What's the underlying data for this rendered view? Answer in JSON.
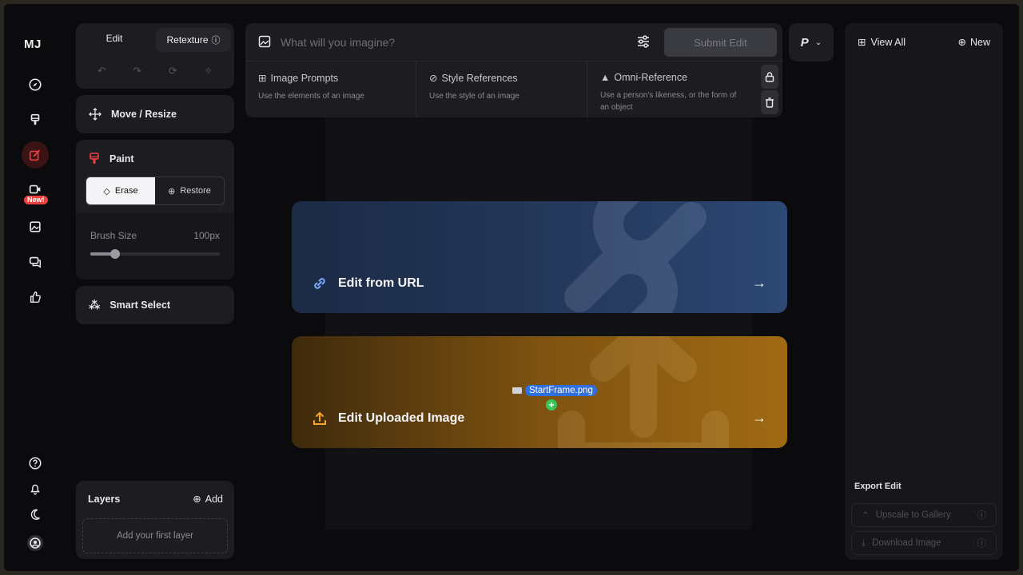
{
  "rail": {
    "logo": "MJ",
    "new_badge": "New!",
    "items": [
      {
        "icon": "compass-icon"
      },
      {
        "icon": "brush-icon"
      },
      {
        "icon": "edit-icon"
      },
      {
        "icon": "video-icon"
      },
      {
        "icon": "image-icon"
      },
      {
        "icon": "chat-icon"
      },
      {
        "icon": "thumbs-up-icon"
      }
    ],
    "bottom": [
      {
        "icon": "help-icon"
      },
      {
        "icon": "bell-icon"
      },
      {
        "icon": "moon-icon"
      },
      {
        "icon": "profile-icon"
      }
    ]
  },
  "tools": {
    "tab_edit": "Edit",
    "tab_retexture": "Retexture",
    "move_resize": "Move / Resize",
    "paint": {
      "title": "Paint",
      "erase": "Erase",
      "restore": "Restore",
      "brush_size_label": "Brush Size",
      "brush_size_value": "100px",
      "brush_fraction": 0.19
    },
    "smart_select": "Smart Select",
    "layers": {
      "title": "Layers",
      "add": "Add",
      "empty": "Add your first layer"
    }
  },
  "prompt": {
    "placeholder": "What will you imagine?",
    "submit": "Submit Edit",
    "refs": [
      {
        "title": "Image Prompts",
        "sub": "Use the elements of an image"
      },
      {
        "title": "Style References",
        "sub": "Use the style of an image"
      },
      {
        "title": "Omni-Reference",
        "sub": "Use a person's likeness, or the form of an object"
      }
    ]
  },
  "mode": {
    "label": "P"
  },
  "cards": {
    "url": "Edit from URL",
    "upload": "Edit Uploaded Image",
    "drag_file": "StartFrame.png"
  },
  "right": {
    "view_all": "View All",
    "new": "New",
    "export_title": "Export Edit",
    "upscale": "Upscale to Gallery",
    "download": "Download Image"
  },
  "colors": {
    "accent_red": "#ef4040",
    "url_card": "#253a5e",
    "upload_card": "#7e5210",
    "upload_icon": "#f5a623"
  }
}
